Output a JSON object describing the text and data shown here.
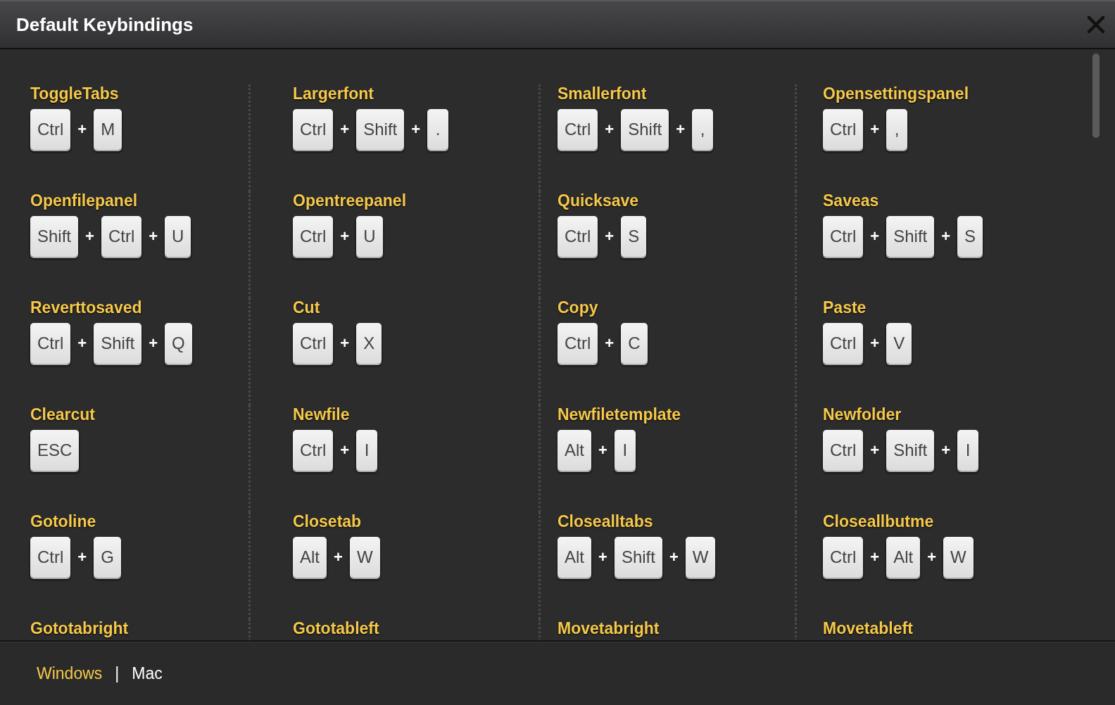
{
  "window": {
    "title": "Default Keybindings"
  },
  "bindings": [
    {
      "action": "ToggleTabs",
      "keys": [
        "Ctrl",
        "M"
      ]
    },
    {
      "action": "Largerfont",
      "keys": [
        "Ctrl",
        "Shift",
        "."
      ]
    },
    {
      "action": "Smallerfont",
      "keys": [
        "Ctrl",
        "Shift",
        ","
      ]
    },
    {
      "action": "Opensettingspanel",
      "keys": [
        "Ctrl",
        ","
      ]
    },
    {
      "action": "Openfilepanel",
      "keys": [
        "Shift",
        "Ctrl",
        "U"
      ]
    },
    {
      "action": "Opentreepanel",
      "keys": [
        "Ctrl",
        "U"
      ]
    },
    {
      "action": "Quicksave",
      "keys": [
        "Ctrl",
        "S"
      ]
    },
    {
      "action": "Saveas",
      "keys": [
        "Ctrl",
        "Shift",
        "S"
      ]
    },
    {
      "action": "Reverttosaved",
      "keys": [
        "Ctrl",
        "Shift",
        "Q"
      ]
    },
    {
      "action": "Cut",
      "keys": [
        "Ctrl",
        "X"
      ]
    },
    {
      "action": "Copy",
      "keys": [
        "Ctrl",
        "C"
      ]
    },
    {
      "action": "Paste",
      "keys": [
        "Ctrl",
        "V"
      ]
    },
    {
      "action": "Clearcut",
      "keys": [
        "ESC"
      ]
    },
    {
      "action": "Newfile",
      "keys": [
        "Ctrl",
        "I"
      ]
    },
    {
      "action": "Newfiletemplate",
      "keys": [
        "Alt",
        "I"
      ]
    },
    {
      "action": "Newfolder",
      "keys": [
        "Ctrl",
        "Shift",
        "I"
      ]
    },
    {
      "action": "Gotoline",
      "keys": [
        "Ctrl",
        "G"
      ]
    },
    {
      "action": "Closetab",
      "keys": [
        "Alt",
        "W"
      ]
    },
    {
      "action": "Closealltabs",
      "keys": [
        "Alt",
        "Shift",
        "W"
      ]
    },
    {
      "action": "Closeallbutme",
      "keys": [
        "Ctrl",
        "Alt",
        "W"
      ]
    },
    {
      "action": "Gototabright"
    },
    {
      "action": "Gototableft"
    },
    {
      "action": "Movetabright"
    },
    {
      "action": "Movetableft"
    }
  ],
  "key_joiner": "+",
  "footer": {
    "platforms": [
      {
        "label": "Windows",
        "selected": true
      },
      {
        "label": "Mac",
        "selected": false
      }
    ],
    "separator": "|"
  }
}
